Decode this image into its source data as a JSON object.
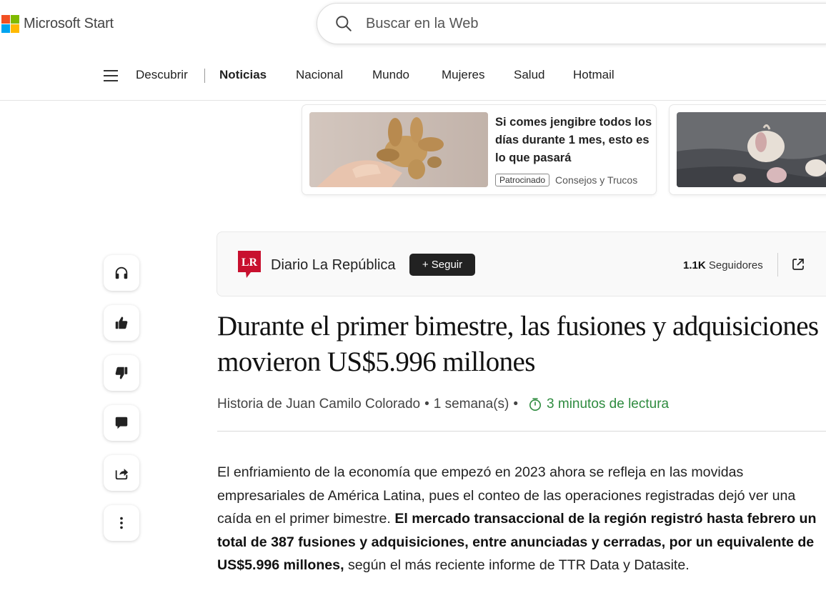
{
  "header": {
    "brand": "Microsoft Start",
    "search_placeholder": "Buscar en la Web"
  },
  "nav": {
    "items": [
      "Descubrir",
      "Noticias",
      "Nacional",
      "Mundo",
      "Mujeres",
      "Salud",
      "Hotmail"
    ],
    "active": "Noticias"
  },
  "promos": [
    {
      "title": "Si comes jengibre todos los días durante 1 mes, esto es lo que pasará",
      "badge": "Patrocinado",
      "source": "Consejos y Trucos"
    }
  ],
  "publisher": {
    "logo_text": "LR",
    "name": "Diario La República",
    "follow_label": "+ Seguir",
    "followers_count": "1.1K",
    "followers_label": "Seguidores"
  },
  "article": {
    "headline": "Durante el primer bimestre, las fusiones y adquisiciones movieron US$5.996 millones",
    "author": "Historia de Juan Camilo Colorado",
    "age": "1 semana(s)",
    "separator": "•",
    "read_time": "3 minutos de lectura",
    "body": {
      "part1": "El enfriamiento de la economía que empezó en 2023 ahora se refleja en las movidas empresariales de América Latina, pues el conteo de las operaciones registradas dejó ver una caída en el primer bimestre.",
      "bold": "El mercado transaccional de la región registró hasta febrero un total de 387 fusiones y adquisiciones, entre anunciadas y cerradas, por un equivalente de US$5.996 millones,",
      "part2": "según el más reciente informe de TTR Data y Datasite."
    }
  },
  "rail": [
    "headphones-icon",
    "thumbs-up-icon",
    "thumbs-down-icon",
    "comment-icon",
    "share-icon",
    "more-options-icon"
  ],
  "colors": {
    "ms_red": "#f25022",
    "ms_green": "#7fba00",
    "ms_blue": "#00a4ef",
    "ms_yellow": "#ffb900",
    "read_time_green": "#2e8b3f",
    "publisher_red": "#c8102e"
  }
}
